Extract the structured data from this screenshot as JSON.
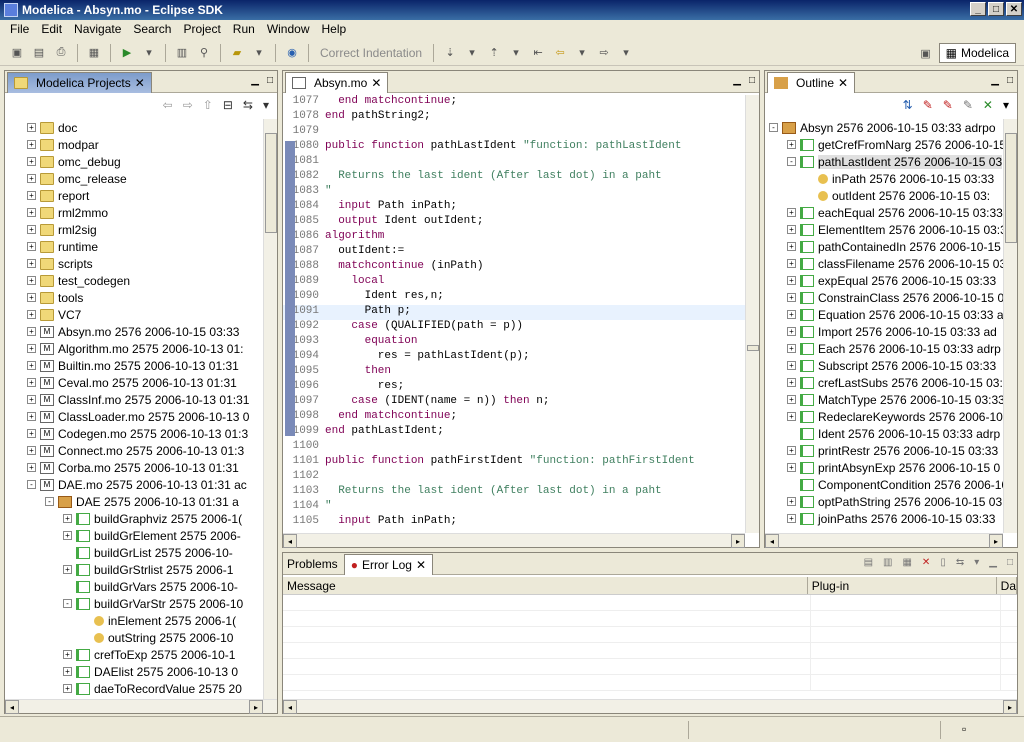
{
  "window": {
    "title": "Modelica - Absyn.mo - Eclipse SDK"
  },
  "menu": [
    "File",
    "Edit",
    "Navigate",
    "Search",
    "Project",
    "Run",
    "Window",
    "Help"
  ],
  "toolbar": {
    "correct_indentation": "Correct Indentation",
    "perspective": "Modelica"
  },
  "projects": {
    "tab": "Modelica Projects",
    "rows": [
      {
        "indent": 1,
        "exp": "+",
        "icon": "folder",
        "label": "doc"
      },
      {
        "indent": 1,
        "exp": "+",
        "icon": "folder",
        "label": "modpar"
      },
      {
        "indent": 1,
        "exp": "+",
        "icon": "folder",
        "label": "omc_debug"
      },
      {
        "indent": 1,
        "exp": "+",
        "icon": "folder",
        "label": "omc_release"
      },
      {
        "indent": 1,
        "exp": "+",
        "icon": "folder",
        "label": "report"
      },
      {
        "indent": 1,
        "exp": "+",
        "icon": "folder",
        "label": "rml2mmo"
      },
      {
        "indent": 1,
        "exp": "+",
        "icon": "folder",
        "label": "rml2sig"
      },
      {
        "indent": 1,
        "exp": "+",
        "icon": "folder",
        "label": "runtime"
      },
      {
        "indent": 1,
        "exp": "+",
        "icon": "folder",
        "label": "scripts"
      },
      {
        "indent": 1,
        "exp": "+",
        "icon": "folder",
        "label": "test_codegen"
      },
      {
        "indent": 1,
        "exp": "+",
        "icon": "folder",
        "label": "tools"
      },
      {
        "indent": 1,
        "exp": "+",
        "icon": "folder",
        "label": "VC7"
      },
      {
        "indent": 1,
        "exp": "+",
        "icon": "file",
        "label": "Absyn.mo 2576  2006-10-15 03:33"
      },
      {
        "indent": 1,
        "exp": "+",
        "icon": "file",
        "label": "Algorithm.mo 2575  2006-10-13 01:"
      },
      {
        "indent": 1,
        "exp": "+",
        "icon": "file",
        "label": "Builtin.mo 2575  2006-10-13 01:31"
      },
      {
        "indent": 1,
        "exp": "+",
        "icon": "file",
        "label": "Ceval.mo 2575  2006-10-13 01:31"
      },
      {
        "indent": 1,
        "exp": "+",
        "icon": "file",
        "label": "ClassInf.mo 2575  2006-10-13 01:31"
      },
      {
        "indent": 1,
        "exp": "+",
        "icon": "file",
        "label": "ClassLoader.mo 2575  2006-10-13 0"
      },
      {
        "indent": 1,
        "exp": "+",
        "icon": "file",
        "label": "Codegen.mo 2575  2006-10-13 01:3"
      },
      {
        "indent": 1,
        "exp": "+",
        "icon": "file",
        "label": "Connect.mo 2575  2006-10-13 01:3"
      },
      {
        "indent": 1,
        "exp": "+",
        "icon": "file",
        "label": "Corba.mo 2575  2006-10-13 01:31"
      },
      {
        "indent": 1,
        "exp": "-",
        "icon": "file",
        "label": "DAE.mo 2575  2006-10-13 01:31  ac"
      },
      {
        "indent": 2,
        "exp": "-",
        "icon": "pkg",
        "label": "DAE 2575  2006-10-13 01:31  a"
      },
      {
        "indent": 3,
        "exp": "+",
        "icon": "func",
        "label": "buildGraphviz 2575  2006-1("
      },
      {
        "indent": 3,
        "exp": "+",
        "icon": "func",
        "label": "buildGrElement 2575  2006-"
      },
      {
        "indent": 3,
        "exp": "",
        "icon": "func",
        "label": "buildGrList 2575  2006-10-"
      },
      {
        "indent": 3,
        "exp": "+",
        "icon": "func",
        "label": "buildGrStrlist 2575  2006-1"
      },
      {
        "indent": 3,
        "exp": "",
        "icon": "func",
        "label": "buildGrVars 2575  2006-10-"
      },
      {
        "indent": 3,
        "exp": "-",
        "icon": "func",
        "label": "buildGrVarStr 2575  2006-10"
      },
      {
        "indent": 4,
        "exp": "",
        "icon": "var",
        "label": "inElement 2575  2006-1("
      },
      {
        "indent": 4,
        "exp": "",
        "icon": "var",
        "label": "outString 2575  2006-10"
      },
      {
        "indent": 3,
        "exp": "+",
        "icon": "func",
        "label": "crefToExp 2575  2006-10-1"
      },
      {
        "indent": 3,
        "exp": "+",
        "icon": "func",
        "label": "DAElist 2575  2006-10-13 0"
      },
      {
        "indent": 3,
        "exp": "+",
        "icon": "func",
        "label": "daeToRecordValue 2575  20"
      }
    ]
  },
  "editor": {
    "tab": "Absyn.mo",
    "lines": [
      {
        "n": "1077",
        "t": "  end matchcontinue;",
        "c": "kwline"
      },
      {
        "n": "1078",
        "t": "end pathString2;",
        "c": "kwline"
      },
      {
        "n": "1079",
        "t": "",
        "c": ""
      },
      {
        "n": "1080",
        "t": "public function pathLastIdent \"function: pathLastIdent",
        "c": "fn"
      },
      {
        "n": "1081",
        "t": "",
        "c": ""
      },
      {
        "n": "1082",
        "t": "  Returns the last ident (After last dot) in a paht",
        "c": "cm"
      },
      {
        "n": "1083",
        "t": "\"",
        "c": "cm"
      },
      {
        "n": "1084",
        "t": "  input Path inPath;",
        "c": "kwline"
      },
      {
        "n": "1085",
        "t": "  output Ident outIdent;",
        "c": "kwline"
      },
      {
        "n": "1086",
        "t": "algorithm",
        "c": "kw"
      },
      {
        "n": "1087",
        "t": "  outIdent:=",
        "c": ""
      },
      {
        "n": "1088",
        "t": "  matchcontinue (inPath)",
        "c": "kwline"
      },
      {
        "n": "1089",
        "t": "    local",
        "c": "kw"
      },
      {
        "n": "1090",
        "t": "      Ident res,n;",
        "c": ""
      },
      {
        "n": "1091",
        "t": "      Path p;",
        "c": "hl"
      },
      {
        "n": "1092",
        "t": "    case (QUALIFIED(path = p))",
        "c": "kwline"
      },
      {
        "n": "1093",
        "t": "      equation",
        "c": "kw"
      },
      {
        "n": "1094",
        "t": "        res = pathLastIdent(p);",
        "c": ""
      },
      {
        "n": "1095",
        "t": "      then",
        "c": "kw"
      },
      {
        "n": "1096",
        "t": "        res;",
        "c": ""
      },
      {
        "n": "1097",
        "t": "    case (IDENT(name = n)) then n;",
        "c": "kwline"
      },
      {
        "n": "1098",
        "t": "  end matchcontinue;",
        "c": "kwline"
      },
      {
        "n": "1099",
        "t": "end pathLastIdent;",
        "c": "kwline"
      },
      {
        "n": "1100",
        "t": "",
        "c": ""
      },
      {
        "n": "1101",
        "t": "public function pathFirstIdent \"function: pathFirstIdent",
        "c": "fn"
      },
      {
        "n": "1102",
        "t": "",
        "c": ""
      },
      {
        "n": "1103",
        "t": "  Returns the last ident (After last dot) in a paht",
        "c": "cm"
      },
      {
        "n": "1104",
        "t": "\"",
        "c": "cm"
      },
      {
        "n": "1105",
        "t": "  input Path inPath;",
        "c": "kwline"
      }
    ]
  },
  "outline": {
    "tab": "Outline",
    "rows": [
      {
        "indent": 0,
        "exp": "-",
        "icon": "pkg",
        "label": "Absyn 2576  2006-10-15 03:33  adrpo"
      },
      {
        "indent": 1,
        "exp": "+",
        "icon": "func",
        "label": "getCrefFromNarg 2576  2006-10-15"
      },
      {
        "indent": 1,
        "exp": "-",
        "icon": "func",
        "label": "pathLastIdent 2576  2006-10-15 03"
      },
      {
        "indent": 2,
        "exp": "",
        "icon": "var",
        "label": "inPath 2576  2006-10-15 03:33"
      },
      {
        "indent": 2,
        "exp": "",
        "icon": "var",
        "label": "outIdent 2576  2006-10-15 03:"
      },
      {
        "indent": 1,
        "exp": "+",
        "icon": "func",
        "label": "eachEqual 2576  2006-10-15 03:33"
      },
      {
        "indent": 1,
        "exp": "+",
        "icon": "func",
        "label": "ElementItem 2576  2006-10-15 03:3"
      },
      {
        "indent": 1,
        "exp": "+",
        "icon": "func",
        "label": "pathContainedIn 2576  2006-10-15"
      },
      {
        "indent": 1,
        "exp": "+",
        "icon": "func",
        "label": "classFilename 2576  2006-10-15 03"
      },
      {
        "indent": 1,
        "exp": "+",
        "icon": "func",
        "label": "expEqual 2576  2006-10-15 03:33"
      },
      {
        "indent": 1,
        "exp": "+",
        "icon": "func",
        "label": "ConstrainClass 2576  2006-10-15 0"
      },
      {
        "indent": 1,
        "exp": "+",
        "icon": "func",
        "label": "Equation 2576  2006-10-15 03:33  a"
      },
      {
        "indent": 1,
        "exp": "+",
        "icon": "func",
        "label": "Import 2576  2006-10-15 03:33  ad"
      },
      {
        "indent": 1,
        "exp": "+",
        "icon": "func",
        "label": "Each 2576  2006-10-15 03:33  adrp"
      },
      {
        "indent": 1,
        "exp": "+",
        "icon": "func",
        "label": "Subscript 2576  2006-10-15 03:33"
      },
      {
        "indent": 1,
        "exp": "+",
        "icon": "func",
        "label": "crefLastSubs 2576  2006-10-15 03:"
      },
      {
        "indent": 1,
        "exp": "+",
        "icon": "func",
        "label": "MatchType 2576  2006-10-15 03:33"
      },
      {
        "indent": 1,
        "exp": "+",
        "icon": "func",
        "label": "RedeclareKeywords 2576  2006-10-"
      },
      {
        "indent": 1,
        "exp": "",
        "icon": "func",
        "label": "Ident 2576  2006-10-15 03:33  adrp"
      },
      {
        "indent": 1,
        "exp": "+",
        "icon": "func",
        "label": "printRestr 2576  2006-10-15 03:33"
      },
      {
        "indent": 1,
        "exp": "+",
        "icon": "func",
        "label": "printAbsynExp 2576  2006-10-15 0"
      },
      {
        "indent": 1,
        "exp": "",
        "icon": "func",
        "label": "ComponentCondition 2576  2006-10"
      },
      {
        "indent": 1,
        "exp": "+",
        "icon": "func",
        "label": "optPathString 2576  2006-10-15 03"
      },
      {
        "indent": 1,
        "exp": "+",
        "icon": "func",
        "label": "joinPaths 2576  2006-10-15 03:33"
      }
    ]
  },
  "bottom": {
    "tabs": [
      "Problems",
      "Error Log"
    ],
    "columns": [
      "Message",
      "Plug-in",
      "Da"
    ]
  }
}
